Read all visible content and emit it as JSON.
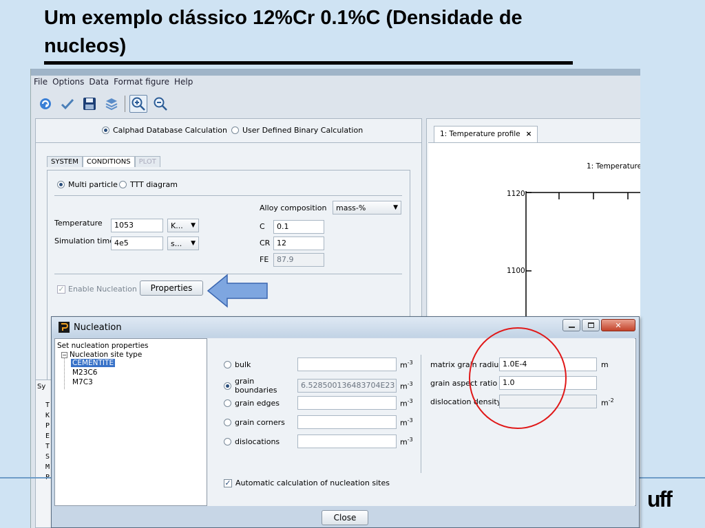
{
  "slide": {
    "title_line1": "Um exemplo clássico 12%Cr 0.1%C  (Densidade de",
    "title_line2": "nucleos)",
    "logo_text": "uff"
  },
  "menu": [
    "File",
    "Options",
    "Data",
    "Format figure",
    "Help"
  ],
  "toolbar_icons": [
    "refresh-icon",
    "check-icon",
    "save-icon",
    "layers-icon",
    "zoom-in-icon",
    "zoom-out-icon"
  ],
  "calc_mode": {
    "calphad_label": "Calphad Database Calculation",
    "binary_label": "User Defined Binary Calculation",
    "selected": "calphad"
  },
  "tabs": [
    {
      "label": "SYSTEM",
      "state": "normal"
    },
    {
      "label": "CONDITIONS",
      "state": "active"
    },
    {
      "label": "PLOT",
      "state": "disabled"
    }
  ],
  "particle_mode": {
    "multi_label": "Multi particle",
    "ttt_label": "TTT diagram",
    "selected": "multi"
  },
  "conditions": {
    "temperature_label": "Temperature",
    "temperature_value": "1053",
    "temperature_unit": "K...",
    "sim_time_label": "Simulation time",
    "sim_time_value": "4e5",
    "sim_time_unit": "s..."
  },
  "alloy": {
    "label": "Alloy composition",
    "unit": "mass-%",
    "elements": [
      {
        "name": "C",
        "value": "0.1",
        "editable": true
      },
      {
        "name": "CR",
        "value": "12",
        "editable": true
      },
      {
        "name": "FE",
        "value": "87.9",
        "editable": false
      }
    ]
  },
  "nucleation": {
    "enable_label": "Enable Nucleation",
    "enabled": true,
    "properties_label": "Properties"
  },
  "right_panel": {
    "tab_label": "1: Temperature profile",
    "tab_close": "×",
    "plot_title": "1: Temperature",
    "y_ticks": [
      "1120",
      "1100"
    ]
  },
  "dialog": {
    "title": "Nucleation",
    "tree": {
      "root": "Set nucleation properties",
      "site_type": "Nucleation site type",
      "children": [
        "CEMENTITE",
        "M23C6",
        "M7C3"
      ],
      "selected": "CEMENTITE"
    },
    "sites": [
      {
        "label": "bulk",
        "value": "",
        "unit": "m",
        "exp": "-3",
        "selected": false,
        "readonly": false
      },
      {
        "label": "grain boundaries",
        "value": "6.528500136483704E23",
        "unit": "m",
        "exp": "-3",
        "selected": true,
        "readonly": true
      },
      {
        "label": "grain edges",
        "value": "",
        "unit": "m",
        "exp": "-3",
        "selected": false,
        "readonly": false
      },
      {
        "label": "grain corners",
        "value": "",
        "unit": "m",
        "exp": "-3",
        "selected": false,
        "readonly": false
      },
      {
        "label": "dislocations",
        "value": "",
        "unit": "m",
        "exp": "-3",
        "selected": false,
        "readonly": false
      }
    ],
    "params": [
      {
        "label": "matrix grain radius",
        "value": "1.0E-4",
        "unit": "m",
        "exp": ""
      },
      {
        "label": "grain aspect ratio",
        "value": "1.0",
        "unit": "",
        "exp": ""
      },
      {
        "label": "dislocation density",
        "value": "",
        "unit": "m",
        "exp": "-2"
      }
    ],
    "auto_calc_label": "Automatic calculation of nucleation sites",
    "auto_calc_checked": true,
    "close_label": "Close"
  },
  "background_console": {
    "tab_fragment": "Sy",
    "letters": [
      "T",
      "K",
      "P",
      "E",
      "T",
      "S",
      "M",
      "P"
    ]
  },
  "colors": {
    "slide_bg": "#cfe3f3",
    "selection": "#3872c8",
    "annotation_circle": "#e01818",
    "annotation_arrow": "#7ea6e0"
  }
}
